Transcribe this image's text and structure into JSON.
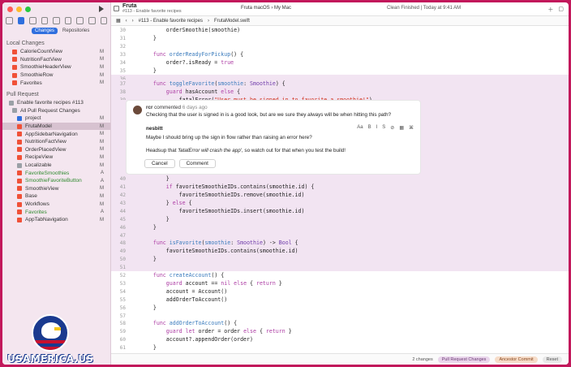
{
  "window": {
    "project_title": "Fruta",
    "project_subtitle": "#113 - Enable favorite recipes",
    "scheme": "Fruta macOS  ›  My Mac",
    "status": "Clean Finished | Today at 9:41 AM"
  },
  "sidebar": {
    "tabs": [
      "Changes",
      "Repositories"
    ],
    "local_changes_title": "Local Changes",
    "local_changes": [
      {
        "label": "CalorieCountView",
        "status": "M"
      },
      {
        "label": "NutritionFactView",
        "status": "M"
      },
      {
        "label": "SmoothieHeaderView",
        "status": "M"
      },
      {
        "label": "SmoothieRow",
        "status": "M"
      },
      {
        "label": "Favorites",
        "status": "M"
      }
    ],
    "pull_request_title": "Pull Request",
    "pr_name": "Enable favorite recipes #113",
    "all_changes_label": "All Pull Request Changes",
    "pr_files": [
      {
        "label": "project",
        "status": "M",
        "kind": "blue"
      },
      {
        "label": "FrutaModel",
        "status": "M",
        "selected": true
      },
      {
        "label": "AppSidebarNavigation",
        "status": "M"
      },
      {
        "label": "NutritionFactView",
        "status": "M"
      },
      {
        "label": "OrderPlacedView",
        "status": "M"
      },
      {
        "label": "RecipeView",
        "status": "M"
      },
      {
        "label": "Localizable",
        "status": "M",
        "kind": "gray"
      },
      {
        "label": "FavoriteSmoothies",
        "status": "A",
        "added": true
      },
      {
        "label": "SmoothieFavoriteButton",
        "status": "A",
        "added": true
      },
      {
        "label": "SmoothieView",
        "status": "M"
      },
      {
        "label": "Base",
        "status": "M"
      },
      {
        "label": "Workflows",
        "status": "M"
      },
      {
        "label": "Favorites",
        "status": "A",
        "added": true
      },
      {
        "label": "AppTabNavigation",
        "status": "M"
      }
    ]
  },
  "logo_text": "USAMERICA.US",
  "tabbar": {
    "pr": "#113 - Enable favorite recipes",
    "file": "FrutaModel.swift"
  },
  "comment": {
    "author": "rcr",
    "verb": "commented",
    "time": "6 days ago",
    "body": "Checking that the user is signed in is a good look, but are we sure they always will be when hitting this path?"
  },
  "reply": {
    "author": "nesbitt",
    "line1": "Maybe I should bring up the sign in flow rather than raising an error here?",
    "line2_pre": "Headsup that ",
    "line2_em": "'fatalError will crash the app'",
    "line2_post": ", so watch out for that when you test the build!",
    "cancel": "Cancel",
    "submit": "Comment",
    "tools": [
      "Aa",
      "B",
      "I",
      "S",
      "⊘",
      "▦",
      "⌘"
    ]
  },
  "bottom": {
    "changes": "2 changes",
    "pr_changes": "Pull Request Changes",
    "ancestor": "Ancestor Commit",
    "reset": "Reset"
  },
  "colors": {
    "frame": "#c2185b",
    "sidebar": "#f4e6ef",
    "highlight": "#f2e4f2",
    "accent": "#2f6fde",
    "swift": "#f05138"
  }
}
